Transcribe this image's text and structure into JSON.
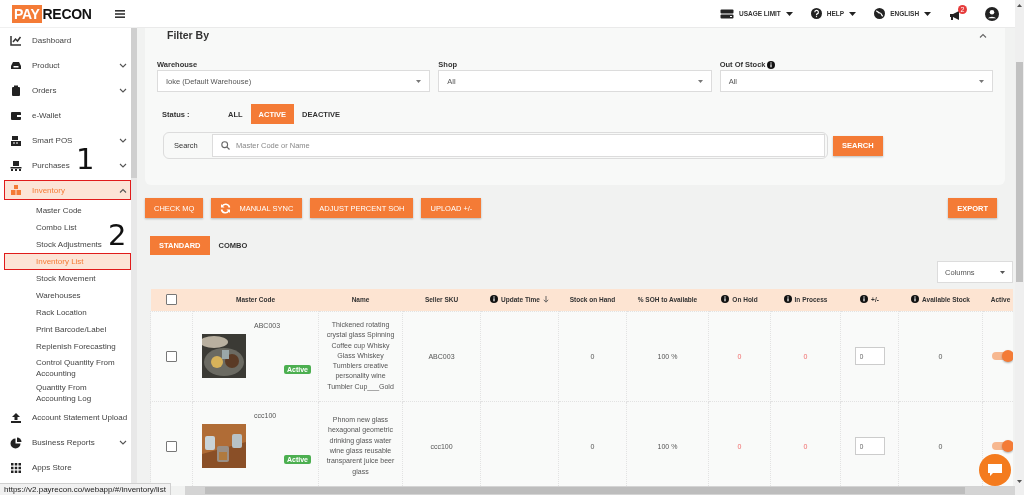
{
  "sidebar": {
    "logo": {
      "mark": "PAY",
      "word": "RECON"
    },
    "items": [
      {
        "label": "Dashboard",
        "kind": "link",
        "selected": false
      },
      {
        "label": "Product",
        "kind": "group",
        "selected": false,
        "expanded": false
      },
      {
        "label": "Orders",
        "kind": "group",
        "selected": false,
        "expanded": false
      },
      {
        "label": "e-Wallet",
        "kind": "link",
        "selected": false
      },
      {
        "label": "Smart POS",
        "kind": "group",
        "selected": false,
        "expanded": false
      },
      {
        "label": "Purchases",
        "kind": "group",
        "selected": false,
        "expanded": false
      },
      {
        "label": "Inventory",
        "kind": "group",
        "selected": true,
        "expanded": true,
        "boxed": true,
        "annotation": "1",
        "children": [
          {
            "label": "Master Code",
            "selected": false
          },
          {
            "label": "Combo List",
            "selected": false
          },
          {
            "label": "Stock Adjustments",
            "selected": false
          },
          {
            "label": "Inventory List",
            "selected": true,
            "boxed": true,
            "annotation": "2"
          },
          {
            "label": "Stock Movement",
            "selected": false
          },
          {
            "label": "Warehouses",
            "selected": false
          },
          {
            "label": "Rack Location",
            "selected": false
          },
          {
            "label": "Print Barcode/Label",
            "selected": false
          },
          {
            "label": "Replenish Forecasting",
            "selected": false
          },
          {
            "label": "Control Quantity From Accounting",
            "selected": false
          },
          {
            "label": "Quantity From Accounting Log",
            "selected": false
          }
        ]
      },
      {
        "label": "Account Statement Upload",
        "kind": "link",
        "selected": false
      },
      {
        "label": "Business Reports",
        "kind": "group",
        "selected": false,
        "expanded": false
      },
      {
        "label": "Apps Store",
        "kind": "link",
        "selected": false
      }
    ]
  },
  "topbar": {
    "menus": [
      {
        "label": "USAGE LIMIT"
      },
      {
        "label": "HELP"
      },
      {
        "label": "ENGLISH"
      }
    ],
    "notification_badge": "2"
  },
  "filter": {
    "title": "Filter By",
    "fields": [
      {
        "label": "Warehouse",
        "value": "Ioke (Default Warehouse)",
        "info": false
      },
      {
        "label": "Shop",
        "value": "All",
        "info": false
      },
      {
        "label": "Out Of Stock",
        "value": "All",
        "info": true
      }
    ],
    "status": {
      "label": "Status :",
      "options": [
        {
          "label": "ALL",
          "selected": false
        },
        {
          "label": "ACTIVE",
          "selected": true
        },
        {
          "label": "DEACTIVE",
          "selected": false
        }
      ]
    },
    "search": {
      "label": "Search",
      "placeholder": "Master Code or Name",
      "button": "SEARCH"
    }
  },
  "actions": [
    {
      "label": "CHECK MQ",
      "kind": "text"
    },
    {
      "label": "MANUAL SYNC",
      "kind": "sync"
    },
    {
      "label": "ADJUST PERCENT SOH",
      "kind": "text"
    },
    {
      "label": "UPLOAD +/-",
      "kind": "text"
    }
  ],
  "export_button": "EXPORT",
  "view_tabs": [
    {
      "label": "STANDARD",
      "selected": true
    },
    {
      "label": "COMBO",
      "selected": false
    }
  ],
  "columns_select": {
    "placeholder": "Columns"
  },
  "table": {
    "header_checked": false,
    "columns": [
      {
        "label": "Master Code",
        "info": false,
        "sorted": false
      },
      {
        "label": "Name",
        "info": false,
        "sorted": false
      },
      {
        "label": "Seller SKU",
        "info": false,
        "sorted": false
      },
      {
        "label": "Update Time",
        "info": true,
        "sorted": true
      },
      {
        "label": "Stock on Hand",
        "info": false,
        "sorted": false
      },
      {
        "label": "% SOH to Available",
        "info": false,
        "sorted": false
      },
      {
        "label": "On Hold",
        "info": true,
        "sorted": false
      },
      {
        "label": "In Process",
        "info": true,
        "sorted": false
      },
      {
        "label": "+/-",
        "info": true,
        "sorted": false
      },
      {
        "label": "Available Stock",
        "info": true,
        "sorted": false
      },
      {
        "label": "Active",
        "info": false,
        "sorted": false
      }
    ],
    "rows": [
      {
        "checked": false,
        "master_code": "ABC003",
        "status": "Active",
        "name": "Thickened rotating crystal glass Spinning Coffee cup Whisky Glass Whiskey Tumblers creative personality wine Tumbler Cup___Gold",
        "seller_sku": "ABC003",
        "stock_on_hand": "0",
        "soh_to_available": "100 %",
        "on_hold": "0",
        "in_process": "0",
        "adjust": "0",
        "available_stock": "0",
        "active": true
      },
      {
        "checked": false,
        "master_code": "ccc100",
        "status": "Active",
        "name": "Phnom new glass hexagonal geometric drinking glass water wine glass reusable transparent juice beer glass",
        "seller_sku": "ccc100",
        "stock_on_hand": "0",
        "soh_to_available": "100 %",
        "on_hold": "0",
        "in_process": "0",
        "adjust": "0",
        "available_stock": "0",
        "active": true
      }
    ]
  },
  "status_url": "https://v2.payrecon.co/webapp/#/inventory/list"
}
